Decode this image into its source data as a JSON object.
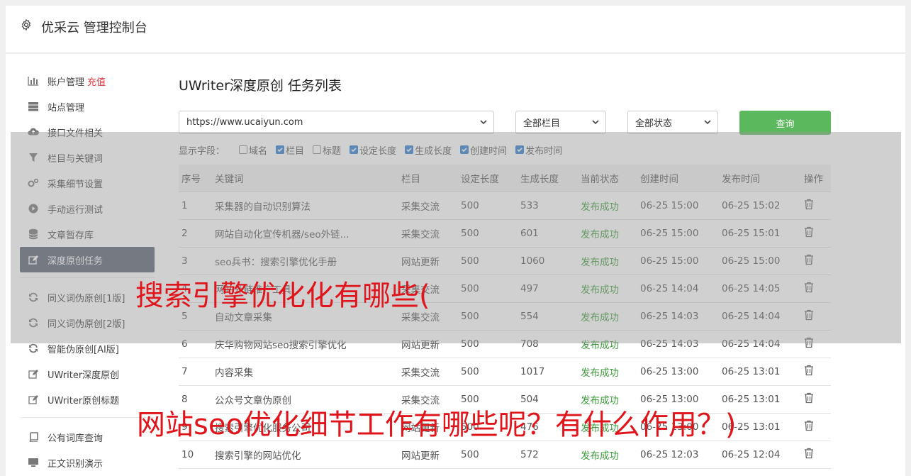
{
  "header": {
    "title": "优采云 管理控制台",
    "icon": "gear-icon"
  },
  "sidebar": {
    "group1": [
      {
        "label": "账户管理",
        "badge": "充值",
        "icon": "bar-chart-icon"
      },
      {
        "label": "站点管理",
        "icon": "server-icon"
      },
      {
        "label": "接口文件相关",
        "icon": "cloud-upload-icon"
      },
      {
        "label": "栏目与关键词",
        "icon": "filter-icon"
      },
      {
        "label": "采集细节设置",
        "icon": "cogs-icon"
      },
      {
        "label": "手动运行测试",
        "icon": "play-circle-icon"
      },
      {
        "label": "文章暂存库",
        "icon": "database-icon"
      },
      {
        "label": "深度原创任务",
        "icon": "edit-icon",
        "active": true
      }
    ],
    "group2": [
      {
        "label": "同义词伪原创[1版]",
        "icon": "refresh-icon"
      },
      {
        "label": "同义词伪原创[2版]",
        "icon": "refresh-icon"
      },
      {
        "label": "智能伪原创[AI版]",
        "icon": "refresh-icon"
      },
      {
        "label": "UWriter深度原创",
        "icon": "edit-icon"
      },
      {
        "label": "UWriter原创标题",
        "icon": "edit-icon"
      }
    ],
    "group3": [
      {
        "label": "公有词库查询",
        "icon": "book-icon"
      },
      {
        "label": "正文识别演示",
        "icon": "monitor-icon"
      }
    ]
  },
  "main": {
    "title": "UWriter深度原创 任务列表",
    "site_select": "https://www.ucaiyun.com",
    "column_select": "全部栏目",
    "status_select": "全部状态",
    "query_button": "查询",
    "fields_label": "显示字段：",
    "fields": [
      {
        "label": "域名",
        "checked": false
      },
      {
        "label": "栏目",
        "checked": true
      },
      {
        "label": "标题",
        "checked": false
      },
      {
        "label": "设定长度",
        "checked": true
      },
      {
        "label": "生成长度",
        "checked": true
      },
      {
        "label": "创建时间",
        "checked": true
      },
      {
        "label": "发布时间",
        "checked": true
      }
    ],
    "table": {
      "headers": [
        "序号",
        "关键词",
        "栏目",
        "设定长度",
        "生成长度",
        "当前状态",
        "创建时间",
        "发布时间",
        "操作"
      ],
      "rows": [
        [
          "1",
          "采集器的自动识别算法",
          "采集交流",
          "500",
          "533",
          "发布成功",
          "06-25 15:00",
          "06-25 15:02"
        ],
        [
          "2",
          "网站自动化宣传机器/seo外链...",
          "采集交流",
          "500",
          "601",
          "发布成功",
          "06-25 15:00",
          "06-25 15:01"
        ],
        [
          "3",
          "seo兵书：搜索引擎优化手册",
          "网站更新",
          "500",
          "1060",
          "发布成功",
          "06-25 15:00",
          "06-25 15:00"
        ],
        [
          "4",
          "网站外链推广工具",
          "采集交流",
          "500",
          "497",
          "发布成功",
          "06-25 14:04",
          "06-25 14:05"
        ],
        [
          "5",
          "自动文章采集",
          "采集交流",
          "500",
          "554",
          "发布成功",
          "06-25 14:03",
          "06-25 14:04"
        ],
        [
          "6",
          "庆华购物网站seo搜索引擎优化",
          "网站更新",
          "500",
          "708",
          "发布成功",
          "06-25 14:03",
          "06-25 14:04"
        ],
        [
          "7",
          "内容采集",
          "采集交流",
          "500",
          "1017",
          "发布成功",
          "06-25 13:00",
          "06-25 13:01"
        ],
        [
          "8",
          "公众号文章伪原创",
          "采集交流",
          "500",
          "504",
          "发布成功",
          "06-25 13:00",
          "06-25 13:01"
        ],
        [
          "9",
          "搜索引擎优化服务公司",
          "网站更新",
          "500",
          "476",
          "发布成功",
          "06-25 13:00",
          "06-25 13:01"
        ],
        [
          "10",
          "搜索引擎的网站优化",
          "网站更新",
          "500",
          "572",
          "发布成功",
          "06-25 12:03",
          "06-25 12:04"
        ]
      ]
    }
  },
  "overlay": {
    "caption1": "搜索引擎优化化有哪些(",
    "caption2": "网站seo优化细节工作有哪些呢？有什么作用？)"
  }
}
